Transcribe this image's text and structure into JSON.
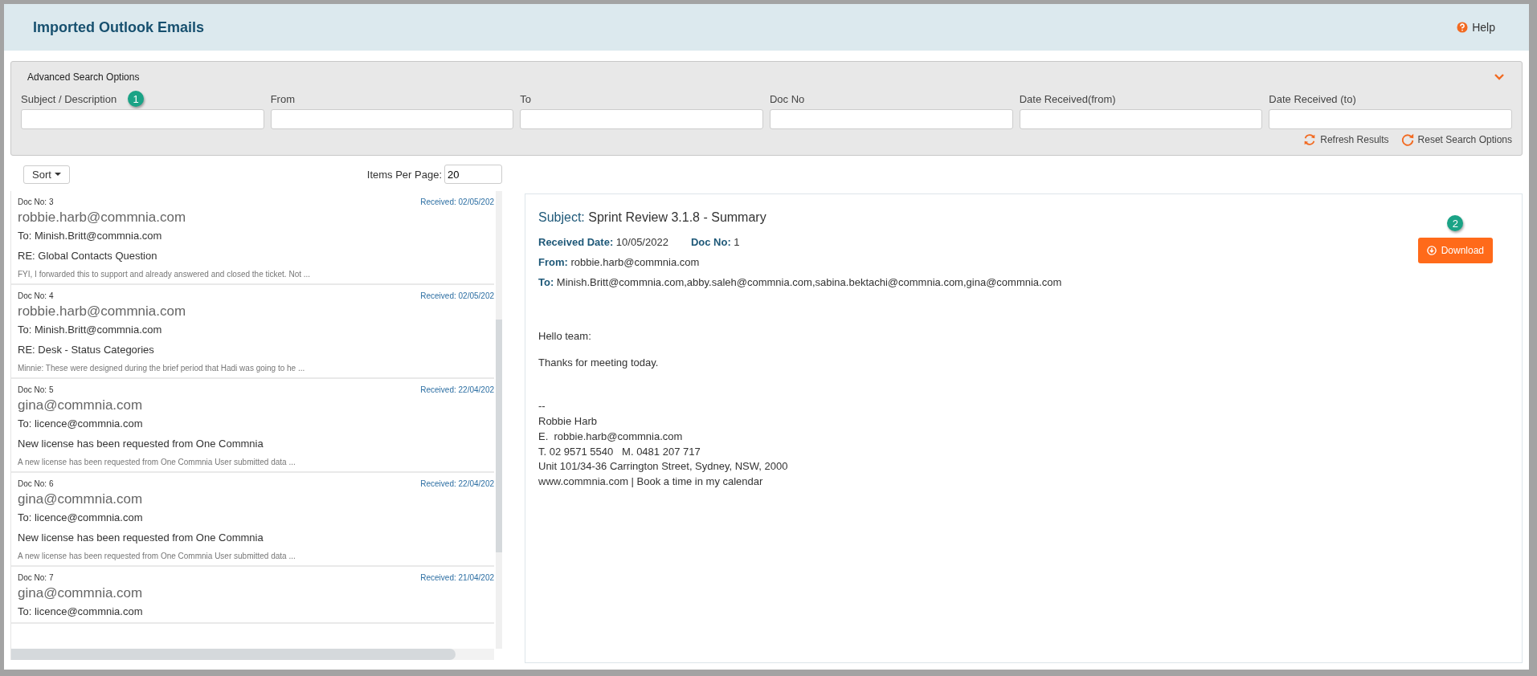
{
  "header": {
    "title": "Imported Outlook Emails",
    "help": "Help"
  },
  "search": {
    "title": "Advanced Search Options",
    "fields": [
      {
        "label": "Subject / Description",
        "badge": "1"
      },
      {
        "label": "From"
      },
      {
        "label": "To"
      },
      {
        "label": "Doc No"
      },
      {
        "label": "Date Received(from)"
      },
      {
        "label": "Date Received (to)"
      }
    ],
    "actions": [
      {
        "label": "Refresh Results",
        "kind": "refresh"
      },
      {
        "label": "Reset Search Options",
        "kind": "reset"
      }
    ]
  },
  "list": {
    "sort": "Sort",
    "items_per_page_label": "Items Per Page:",
    "items_per_page": "20",
    "emails": [
      {
        "doc": "Doc No: 3",
        "received": "Received: 02/05/202",
        "from": "robbie.harb@commnia.com",
        "to": "To: Minish.Britt@commnia.com",
        "subject": "RE: Global Contacts Question",
        "preview": "FYI, I forwarded this to support and already answered and closed the ticket. Not ..."
      },
      {
        "doc": "Doc No: 4",
        "received": "Received: 02/05/202",
        "from": "robbie.harb@commnia.com",
        "to": "To: Minish.Britt@commnia.com",
        "subject": "RE: Desk - Status Categories",
        "preview": "Minnie: These were designed during the brief period that Hadi was going to he ..."
      },
      {
        "doc": "Doc No: 5",
        "received": "Received: 22/04/202",
        "from": "gina@commnia.com",
        "to": "To: licence@commnia.com",
        "subject": "New license has been requested from One Commnia",
        "preview": "A new license has been requested from One Commnia User submitted data ..."
      },
      {
        "doc": "Doc No: 6",
        "received": "Received: 22/04/202",
        "from": "gina@commnia.com",
        "to": "To: licence@commnia.com",
        "subject": "New license has been requested from One Commnia",
        "preview": "A new license has been requested from One Commnia User submitted data ..."
      },
      {
        "doc": "Doc No: 7",
        "received": "Received: 21/04/202",
        "from": "gina@commnia.com",
        "to": "To: licence@commnia.com"
      }
    ]
  },
  "detail": {
    "subject_label": "Subject:",
    "subject": "Sprint Review 3.1.8 - Summary",
    "badge": "2",
    "download": "Download",
    "meta": [
      [
        {
          "label": "Received Date:",
          "value": "10/05/2022"
        },
        {
          "label": "Doc No:",
          "value": "1"
        }
      ],
      [
        {
          "label": "From:",
          "value": "robbie.harb@commnia.com"
        }
      ],
      [
        {
          "label": "To:",
          "value": "Minish.Britt@commnia.com,abby.saleh@commnia.com,sabina.bektachi@commnia.com,gina@commnia.com"
        }
      ]
    ],
    "paragraphs": [
      "Hello team:",
      "Thanks for meeting today."
    ],
    "signature": [
      "--",
      "Robbie Harb",
      "E.  robbie.harb@commnia.com",
      "T. 02 9571 5540   M. 0481 207 717",
      "Unit 101/34-36 Carrington Street, Sydney, NSW, 2000",
      "www.commnia.com | Book a time in my calendar"
    ]
  }
}
